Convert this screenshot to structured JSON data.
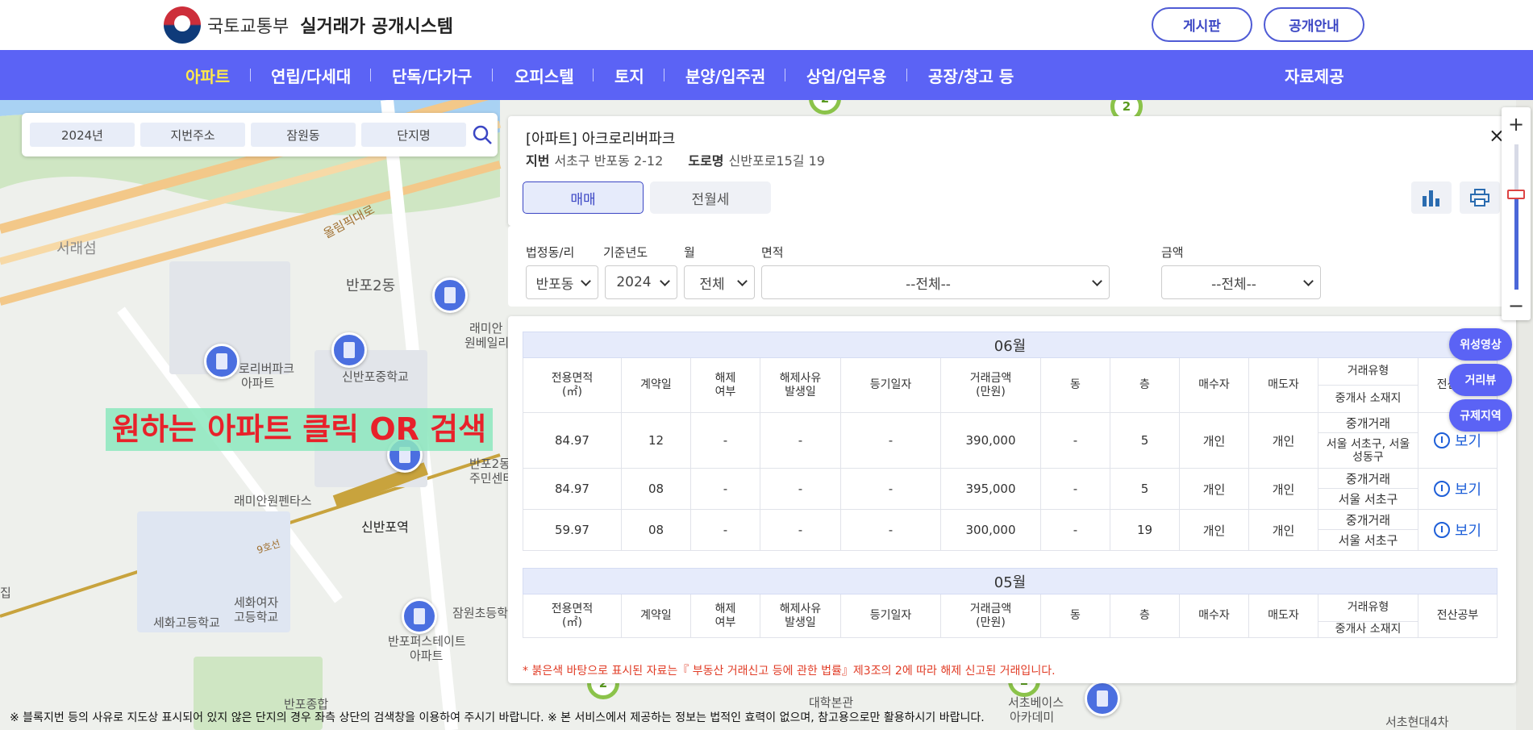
{
  "header": {
    "ministry": "국토교통부",
    "system": "실거래가 공개시스템",
    "board_btn": "게시판",
    "info_btn": "공개안내"
  },
  "nav": {
    "items": [
      "아파트",
      "연립/다세대",
      "단독/다가구",
      "오피스텔",
      "토지",
      "분양/입주권",
      "상업/업무용",
      "공장/창고 등"
    ],
    "data_link": "자료제공"
  },
  "search": {
    "year": "2024년",
    "mode": "지번주소",
    "dong": "잠원동",
    "complex": "단지명"
  },
  "map": {
    "labels": {
      "seoraeseom": "서래섬",
      "banpo2": "반포2동",
      "olympic": "올림픽대로",
      "lamian1": "래미안",
      "lamian2": "원베일리",
      "acro1": "로리버파크",
      "acro2": "아파트",
      "sinbanpo_ms": "신반포중학교",
      "lamian_pent": "래미안원펜타스",
      "sinbanpo_stn": "신반포역",
      "seoha": "세화고등학교",
      "sehwa_girls1": "세화여자",
      "sehwa_girls2": "고등학교",
      "banpo_ce1": "반포2동",
      "banpo_ce2": "주민센터",
      "jamwon_es": "잠원초등학교",
      "banpo_first1": "반포퍼스테이트",
      "banpo_first2": "아파트",
      "banpo_gen": "반포종합",
      "univ": "대학본관",
      "seocho_base1": "서초베이스",
      "seocho_base2": "아카데미",
      "seocho_hd": "서초현대4차",
      "line9": "9호선",
      "jip": "집"
    },
    "clusters": [
      "2",
      "2",
      "2",
      "2"
    ]
  },
  "hint": "원하는 아파트 클릭  OR 검색",
  "panel": {
    "title": "[아파트] 아크로리버파크",
    "jibun_label": "지번",
    "jibun": "서초구 반포동 2-12",
    "road_label": "도로명",
    "road": "신반포로15길 19",
    "tabs": [
      "매매",
      "전월세"
    ],
    "close": "×",
    "filters": {
      "dong_label": "법정동/리",
      "dong": "반포동",
      "year_label": "기준년도",
      "year": "2024",
      "month_label": "월",
      "month": "전체",
      "area_label": "면적",
      "area": "--전체--",
      "price_label": "금액",
      "price": "--전체--"
    },
    "headers": {
      "area": "전용면적\n(㎡)",
      "contract_day": "계약일",
      "cancel": "해제\n여부",
      "cancel_date": "해제사유\n발생일",
      "reg_date": "등기일자",
      "price": "거래금액\n(만원)",
      "dong": "동",
      "floor": "층",
      "buyer": "매수자",
      "seller": "매도자",
      "trade_type": "거래유형",
      "agent_loc": "중개사 소재지",
      "doc": "전산공부"
    },
    "months": [
      {
        "label": "06월",
        "rows": [
          {
            "area": "84.97",
            "day": "12",
            "cancel": "-",
            "cancel_date": "-",
            "reg": "-",
            "price": "390,000",
            "dong": "-",
            "floor": "5",
            "buyer": "개인",
            "seller": "개인",
            "type": "중개거래",
            "agent": "서울 서초구, 서울 성동구",
            "view": "보기"
          },
          {
            "area": "84.97",
            "day": "08",
            "cancel": "-",
            "cancel_date": "-",
            "reg": "-",
            "price": "395,000",
            "dong": "-",
            "floor": "5",
            "buyer": "개인",
            "seller": "개인",
            "type": "중개거래",
            "agent": "서울 서초구",
            "view": "보기"
          },
          {
            "area": "59.97",
            "day": "08",
            "cancel": "-",
            "cancel_date": "-",
            "reg": "-",
            "price": "300,000",
            "dong": "-",
            "floor": "19",
            "buyer": "개인",
            "seller": "개인",
            "type": "중개거래",
            "agent": "서울 서초구",
            "view": "보기"
          }
        ]
      },
      {
        "label": "05월",
        "rows": []
      }
    ],
    "note": "* 붉은색 바탕으로 표시된 자료는『 부동산 거래신고 등에 관한 법률』제3조의 2에 따라 해제 신고된 거래입니다."
  },
  "map_controls": {
    "zoom_in": "+",
    "zoom_out": "−",
    "zoom_level_fraction": 0.65,
    "satellite": "위성영상",
    "street": "거리뷰",
    "regulation": "규제지역"
  },
  "footer": "※ 블록지번 등의 사유로 지도상 표시되어 있지 않은 단지의 경우 좌측 상단의 검색창을 이용하여 주시기 바랍니다. ※ 본 서비스에서 제공하는 정보는 법적인 효력이 없으며, 참고용으로만 활용하시기 바랍니다.",
  "colors": {
    "nav_bg": "#5b63f5",
    "active_nav": "#ffe94a",
    "accent": "#3b46c4",
    "note_red": "#e13c26"
  }
}
